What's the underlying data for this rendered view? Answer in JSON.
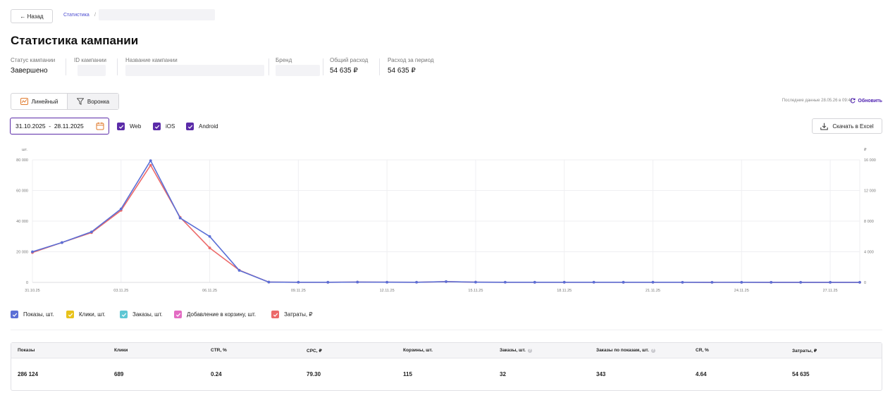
{
  "nav": {
    "back_label": "← Назад",
    "breadcrumb": "Статистика",
    "breadcrumb_sep": "/"
  },
  "page": {
    "title": "Статистика кампании"
  },
  "meta": {
    "status_label": "Статус кампании",
    "status_value": "Завершено",
    "id_label": "ID кампании",
    "name_label": "Название кампании",
    "brand_label": "Бренд",
    "total_label": "Общий расход",
    "total_value": "54 635 ₽",
    "period_label": "Расход за период",
    "period_value": "54 635 ₽"
  },
  "view_toggle": {
    "linear": "Линейный",
    "funnel": "Воронка"
  },
  "last_data": "Последние данные 28.05.26 в 09:41",
  "refresh_label": "Обновить",
  "filters": {
    "date_range": "31.10.2025  -  28.11.2025",
    "platforms": [
      {
        "label": "Web",
        "checked": true
      },
      {
        "label": "iOS",
        "checked": true
      },
      {
        "label": "Android",
        "checked": true
      }
    ]
  },
  "download_label": "Скачать в Excel",
  "legend": [
    {
      "label": "Показы, шт.",
      "color": "#5b6fd6",
      "checked": true
    },
    {
      "label": "Клики, шт.",
      "color": "#e8c21a",
      "checked": true
    },
    {
      "label": "Заказы, шт.",
      "color": "#5ec7d4",
      "checked": true
    },
    {
      "label": "Добавление в корзину, шт.",
      "color": "#e36cc3",
      "checked": true
    },
    {
      "label": "Затраты, ₽",
      "color": "#ec6a6a",
      "checked": true
    }
  ],
  "colors": {
    "accent": "#5b2ba8",
    "impressions": "#5b6fd6",
    "spend": "#ec6a6a"
  },
  "chart_data": {
    "type": "line",
    "left_unit": "шт.",
    "right_unit": "₽",
    "x": [
      "31.10.25",
      "01.11.25",
      "02.11.25",
      "03.11.25",
      "04.11.25",
      "05.11.25",
      "06.11.25",
      "07.11.25",
      "08.11.25",
      "09.11.25",
      "10.11.25",
      "11.11.25",
      "12.11.25",
      "13.11.25",
      "14.11.25",
      "15.11.25",
      "16.11.25",
      "17.11.25",
      "18.11.25",
      "19.11.25",
      "20.11.25",
      "21.11.25",
      "22.11.25",
      "23.11.25",
      "24.11.25",
      "25.11.25",
      "26.11.25",
      "27.11.25",
      "28.11.25"
    ],
    "x_tick_labels": [
      "31.10.25",
      "03.11.25",
      "06.11.25",
      "09.11.25",
      "12.11.25",
      "15.11.25",
      "18.11.25",
      "21.11.25",
      "24.11.25",
      "27.11.25"
    ],
    "yticks_left": [
      "0",
      "20 000",
      "40 000",
      "60 000",
      "80 000"
    ],
    "yticks_right": [
      "0",
      "4 000",
      "8 000",
      "12 000",
      "16 000"
    ],
    "ylim_left": [
      0,
      80000
    ],
    "ylim_right": [
      0,
      16000
    ],
    "series": [
      {
        "name": "Показы, шт.",
        "axis": "left",
        "color": "#5b6fd6",
        "values": [
          20000,
          26000,
          33000,
          48000,
          79500,
          42000,
          30000,
          7800,
          200,
          100,
          80,
          200,
          120,
          100,
          500,
          150,
          100,
          80,
          90,
          100,
          80,
          90,
          70,
          60,
          70,
          60,
          50,
          60,
          50
        ]
      },
      {
        "name": "Затраты, ₽",
        "axis": "right",
        "color": "#ec6a6a",
        "values": [
          3900,
          5200,
          6500,
          9400,
          15300,
          8500,
          4500,
          1600,
          40,
          20,
          15,
          40,
          25,
          20,
          100,
          30,
          20,
          15,
          18,
          20,
          15,
          18,
          14,
          12,
          14,
          12,
          10,
          12,
          10
        ]
      }
    ]
  },
  "table": {
    "headers": [
      {
        "label": "Показы",
        "help": false
      },
      {
        "label": "Клики",
        "help": false
      },
      {
        "label": "CTR, %",
        "help": false
      },
      {
        "label": "CPC, ₽",
        "help": false
      },
      {
        "label": "Корзины, шт.",
        "help": false
      },
      {
        "label": "Заказы, шт.",
        "help": true
      },
      {
        "label": "Заказы по показам, шт.",
        "help": true
      },
      {
        "label": "CR, %",
        "help": false
      },
      {
        "label": "Затраты, ₽",
        "help": false
      }
    ],
    "values": [
      "286 124",
      "689",
      "0.24",
      "79.30",
      "115",
      "32",
      "343",
      "4.64",
      "54 635"
    ]
  }
}
